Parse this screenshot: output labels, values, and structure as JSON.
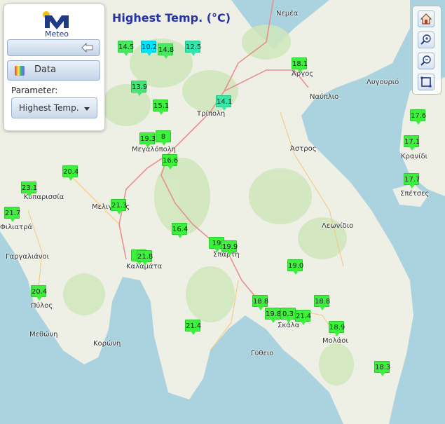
{
  "header": {
    "title": "Highest Temp. (°C)"
  },
  "logo": {
    "text": "Meteo"
  },
  "panel": {
    "data_label": "Data",
    "parameter_label": "Parameter:",
    "parameter_value": "Highest Temp."
  },
  "toolbar": {
    "items": [
      "home-icon",
      "zoom-in-icon",
      "zoom-out-icon",
      "extent-icon"
    ]
  },
  "colors": {
    "sea": "#aad3df",
    "land": "#eef0e6",
    "green_marker": "#3cf03c",
    "cyan_marker": "#00e5ff",
    "teal_marker": "#35e8a8",
    "road": "#e88f8f",
    "title": "#2632a8"
  },
  "places": [
    {
      "name": "Νεμέα"
    },
    {
      "name": "Άργος"
    },
    {
      "name": "Λυγουριό"
    },
    {
      "name": "Ναύπλιο"
    },
    {
      "name": "Τρίπολη"
    },
    {
      "name": "Μεγαλόπολη"
    },
    {
      "name": "Άστρος"
    },
    {
      "name": "Κρανίδι"
    },
    {
      "name": "Σπέτσες"
    },
    {
      "name": "Κυπαρισσία"
    },
    {
      "name": "Μελιγαλάς"
    },
    {
      "name": "Φιλιατρά"
    },
    {
      "name": "Λεωνίδιο"
    },
    {
      "name": "Γαργαλιάνοι"
    },
    {
      "name": "Καλαμάτα"
    },
    {
      "name": "Σπάρτη"
    },
    {
      "name": "Πύλος"
    },
    {
      "name": "Σκάλα"
    },
    {
      "name": "Μεθώνη"
    },
    {
      "name": "Κορώνη"
    },
    {
      "name": "Μολάοι"
    },
    {
      "name": "Γύθειο"
    }
  ],
  "stations": [
    {
      "value": "14.5",
      "color": "#46e85c"
    },
    {
      "value": "10.2",
      "color": "#00e5ff"
    },
    {
      "value": "14.8",
      "color": "#46e85c"
    },
    {
      "value": "12.5",
      "color": "#2fe6b0"
    },
    {
      "value": "13.9",
      "color": "#3de874"
    },
    {
      "value": "15.1",
      "color": "#3cf03c"
    },
    {
      "value": "14.1",
      "color": "#35e8a8"
    },
    {
      "value": "18.1",
      "color": "#3cf03c"
    },
    {
      "value": "19.3",
      "color": "#3cf03c"
    },
    {
      "value": "8",
      "color": "#3cf03c"
    },
    {
      "value": "16.6",
      "color": "#3cf03c"
    },
    {
      "value": "17.6",
      "color": "#3cf03c"
    },
    {
      "value": "17.1",
      "color": "#3cf03c"
    },
    {
      "value": "20.4",
      "color": "#3cf03c"
    },
    {
      "value": "17.7",
      "color": "#3cf03c"
    },
    {
      "value": "23.1",
      "color": "#3cf03c"
    },
    {
      "value": "21.3",
      "color": "#3cf03c"
    },
    {
      "value": "21.7",
      "color": "#3cf03c"
    },
    {
      "value": "16.4",
      "color": "#3cf03c"
    },
    {
      "value": "19",
      "color": "#3cf03c"
    },
    {
      "value": "19.9",
      "color": "#3cf03c"
    },
    {
      "value": "2",
      "color": "#3cf03c"
    },
    {
      "value": "21.8",
      "color": "#3cf03c"
    },
    {
      "value": "19.0",
      "color": "#3cf03c"
    },
    {
      "value": "20.4",
      "color": "#3cf03c"
    },
    {
      "value": "18.8",
      "color": "#3cf03c"
    },
    {
      "value": "18.8",
      "color": "#3cf03c"
    },
    {
      "value": "19.8",
      "color": "#3cf03c"
    },
    {
      "value": "0.3",
      "color": "#3cf03c"
    },
    {
      "value": "21.4",
      "color": "#3cf03c"
    },
    {
      "value": "18.9",
      "color": "#3cf03c"
    },
    {
      "value": "21.4",
      "color": "#3cf03c"
    },
    {
      "value": "18.3",
      "color": "#3cf03c"
    }
  ]
}
